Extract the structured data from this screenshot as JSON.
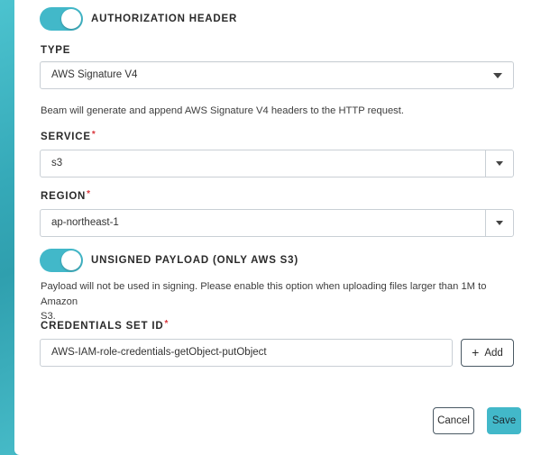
{
  "colors": {
    "accent": "#42b8c9",
    "required": "#d9353b",
    "border": "#c9cfd5",
    "background": "#3fb6c4"
  },
  "authorization": {
    "toggle_label": "AUTHORIZATION HEADER",
    "toggle_on": true
  },
  "type": {
    "label": "TYPE",
    "value": "AWS Signature V4",
    "help": "Beam will generate and append AWS Signature V4 headers to the HTTP request."
  },
  "service": {
    "label": "SERVICE",
    "required_mark": "*",
    "value": "s3"
  },
  "region": {
    "label": "REGION",
    "required_mark": "*",
    "value": "ap-northeast-1"
  },
  "unsigned_payload": {
    "toggle_label": "UNSIGNED PAYLOAD (ONLY AWS S3)",
    "toggle_on": true,
    "help_line1": "Payload will not be used in signing. Please enable this option when uploading files larger than 1M to Amazon",
    "help_line2": "S3."
  },
  "credentials": {
    "label": "CREDENTIALS SET ID",
    "required_mark": "*",
    "value": "AWS-IAM-role-credentials-getObject-putObject",
    "add_icon": "plus-icon",
    "add_label": "Add"
  },
  "actions": {
    "cancel_label": "Cancel",
    "save_label": "Save"
  }
}
